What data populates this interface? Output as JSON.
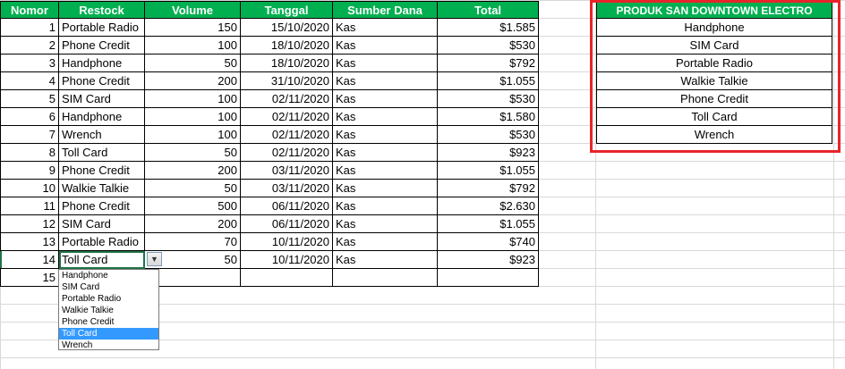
{
  "table": {
    "headers": [
      "Nomor",
      "Restock",
      "Volume",
      "Tanggal",
      "Sumber Dana",
      "Total"
    ],
    "rows": [
      {
        "no": "1",
        "restock": "Portable Radio",
        "volume": "150",
        "tanggal": "15/10/2020",
        "sumber": "Kas",
        "total": "$1.585"
      },
      {
        "no": "2",
        "restock": "Phone Credit",
        "volume": "100",
        "tanggal": "18/10/2020",
        "sumber": "Kas",
        "total": "$530"
      },
      {
        "no": "3",
        "restock": "Handphone",
        "volume": "50",
        "tanggal": "18/10/2020",
        "sumber": "Kas",
        "total": "$792"
      },
      {
        "no": "4",
        "restock": "Phone Credit",
        "volume": "200",
        "tanggal": "31/10/2020",
        "sumber": "Kas",
        "total": "$1.055"
      },
      {
        "no": "5",
        "restock": "SIM Card",
        "volume": "100",
        "tanggal": "02/11/2020",
        "sumber": "Kas",
        "total": "$530"
      },
      {
        "no": "6",
        "restock": "Handphone",
        "volume": "100",
        "tanggal": "02/11/2020",
        "sumber": "Kas",
        "total": "$1.580"
      },
      {
        "no": "7",
        "restock": "Wrench",
        "volume": "100",
        "tanggal": "02/11/2020",
        "sumber": "Kas",
        "total": "$530"
      },
      {
        "no": "8",
        "restock": "Toll Card",
        "volume": "50",
        "tanggal": "02/11/2020",
        "sumber": "Kas",
        "total": "$923"
      },
      {
        "no": "9",
        "restock": "Phone Credit",
        "volume": "200",
        "tanggal": "03/11/2020",
        "sumber": "Kas",
        "total": "$1.055"
      },
      {
        "no": "10",
        "restock": "Walkie Talkie",
        "volume": "50",
        "tanggal": "03/11/2020",
        "sumber": "Kas",
        "total": "$792"
      },
      {
        "no": "11",
        "restock": "Phone Credit",
        "volume": "500",
        "tanggal": "06/11/2020",
        "sumber": "Kas",
        "total": "$2.630"
      },
      {
        "no": "12",
        "restock": "SIM Card",
        "volume": "200",
        "tanggal": "06/11/2020",
        "sumber": "Kas",
        "total": "$1.055"
      },
      {
        "no": "13",
        "restock": "Portable Radio",
        "volume": "70",
        "tanggal": "10/11/2020",
        "sumber": "Kas",
        "total": "$740"
      },
      {
        "no": "14",
        "restock": "Toll Card",
        "volume": "50",
        "tanggal": "10/11/2020",
        "sumber": "Kas",
        "total": "$923"
      },
      {
        "no": "15",
        "restock": "",
        "volume": "",
        "tanggal": "",
        "sumber": "",
        "total": ""
      }
    ]
  },
  "dropdown": {
    "selected": "Toll Card",
    "options": [
      "Handphone",
      "SIM Card",
      "Portable Radio",
      "Walkie Talkie",
      "Phone Credit",
      "Toll Card",
      "Wrench"
    ],
    "active_index": 5
  },
  "products": {
    "title": "PRODUK SAN DOWNTOWN ELECTRO",
    "items": [
      "Handphone",
      "SIM Card",
      "Portable Radio",
      "Walkie Talkie",
      "Phone Credit",
      "Toll Card",
      "Wrench"
    ]
  },
  "colors": {
    "header_green": "#00b050",
    "highlight_red": "#e8242a",
    "selected_option": "#3399ff"
  }
}
